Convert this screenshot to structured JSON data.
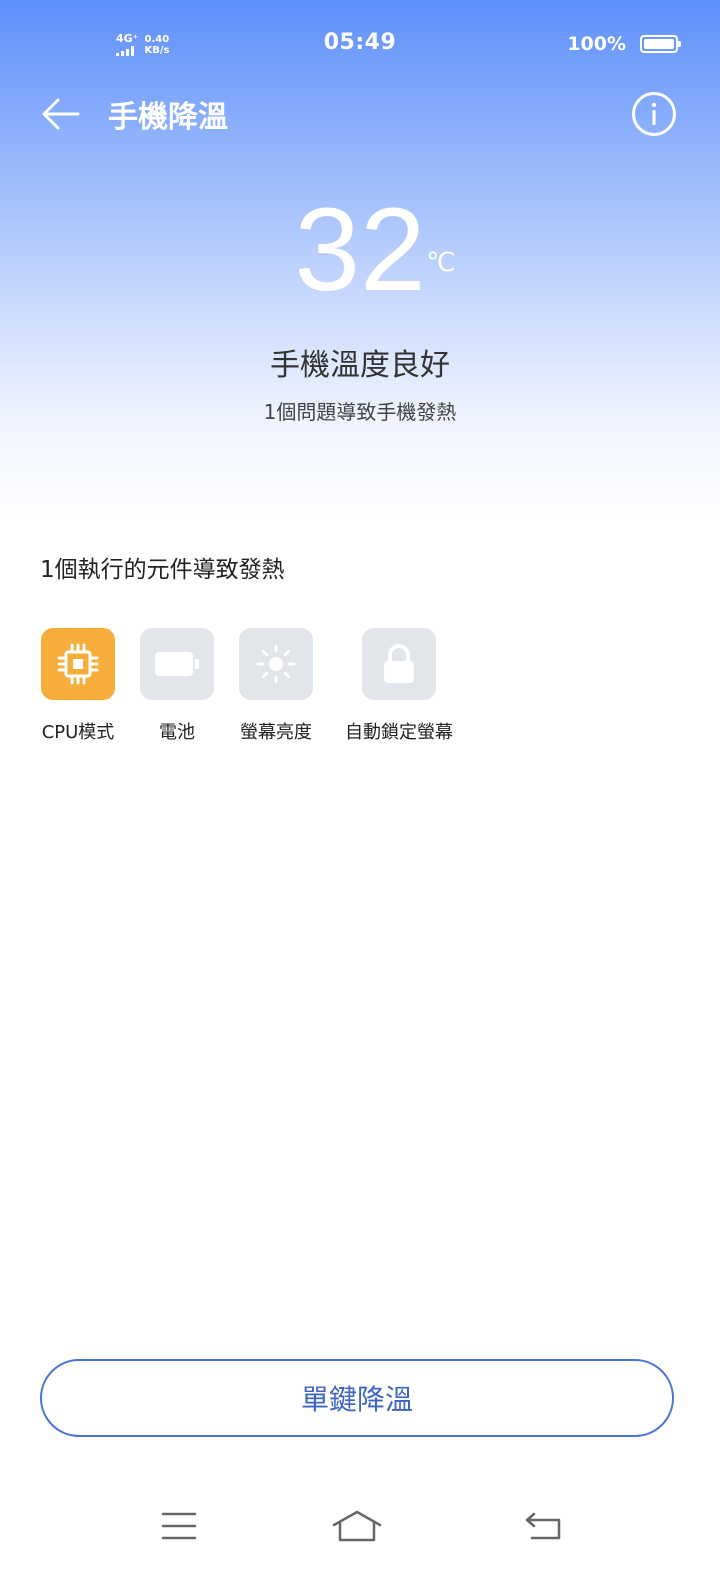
{
  "status_bar": {
    "network_type": "4G⁺",
    "speed_value": "0.40",
    "speed_unit": "KB/s",
    "time": "05:49",
    "battery_percent": "100%"
  },
  "header": {
    "title": "手機降溫"
  },
  "temperature": {
    "value": "32",
    "unit": "℃",
    "status": "手機溫度良好",
    "subtitle": "1個問題導致手機發熱"
  },
  "causes": {
    "title": "1個執行的元件導致發熱",
    "items": [
      {
        "label": "CPU模式",
        "icon": "cpu-icon",
        "active": true
      },
      {
        "label": "電池",
        "icon": "battery-icon",
        "active": false
      },
      {
        "label": "螢幕亮度",
        "icon": "brightness-icon",
        "active": false
      },
      {
        "label": "自動鎖定螢幕",
        "icon": "lock-icon",
        "active": false
      }
    ]
  },
  "action": {
    "cool_label": "單鍵降溫"
  },
  "colors": {
    "accent": "#4a73d6",
    "active_component": "#f6ad3a",
    "inactive_component": "#e2e5e9",
    "header_gradient_top": "#5e8ffb"
  }
}
